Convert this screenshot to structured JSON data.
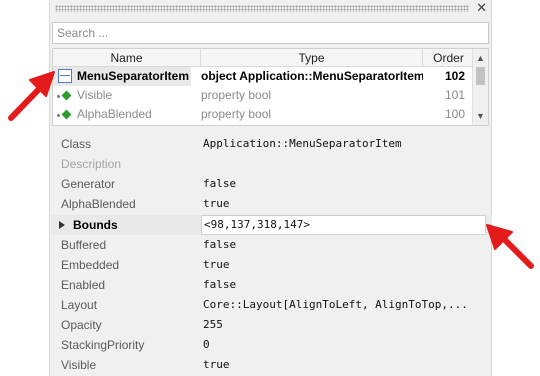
{
  "search": {
    "placeholder": "Search ..."
  },
  "list": {
    "columns": [
      "Name",
      "Type",
      "Order"
    ],
    "rows": [
      {
        "name": "MenuSeparatorItem",
        "type": "object Application::MenuSeparatorItem",
        "order": "102",
        "icon": "separator-icon"
      },
      {
        "name": "Visible",
        "type": "property bool",
        "order": "101",
        "icon": "property-icon"
      },
      {
        "name": "AlphaBlended",
        "type": "property bool",
        "order": "100",
        "icon": "property-icon"
      }
    ]
  },
  "properties": [
    {
      "name": "Class",
      "value": "Application::MenuSeparatorItem"
    },
    {
      "name": "Description",
      "value": ""
    },
    {
      "name": "Generator",
      "value": "false"
    },
    {
      "name": "AlphaBlended",
      "value": "true"
    },
    {
      "name": "Bounds",
      "value": "<98,137,318,147>"
    },
    {
      "name": "Buffered",
      "value": "false"
    },
    {
      "name": "Embedded",
      "value": "true"
    },
    {
      "name": "Enabled",
      "value": "false"
    },
    {
      "name": "Layout",
      "value": "Core::Layout[AlignToLeft, AlignToTop,..."
    },
    {
      "name": "Opacity",
      "value": "255"
    },
    {
      "name": "StackingPriority",
      "value": "0"
    },
    {
      "name": "Visible",
      "value": "true"
    }
  ],
  "colors": {
    "arrow": "#e31b1b",
    "selection": "#e8e8e8",
    "property_icon": "#2e9b2e",
    "separator_icon": "#4f7bc8"
  },
  "icons": {
    "close": "close-icon",
    "expand": "expand-triangle-icon",
    "scroll_up": "scroll-up-icon",
    "scroll_down": "scroll-down-icon"
  }
}
